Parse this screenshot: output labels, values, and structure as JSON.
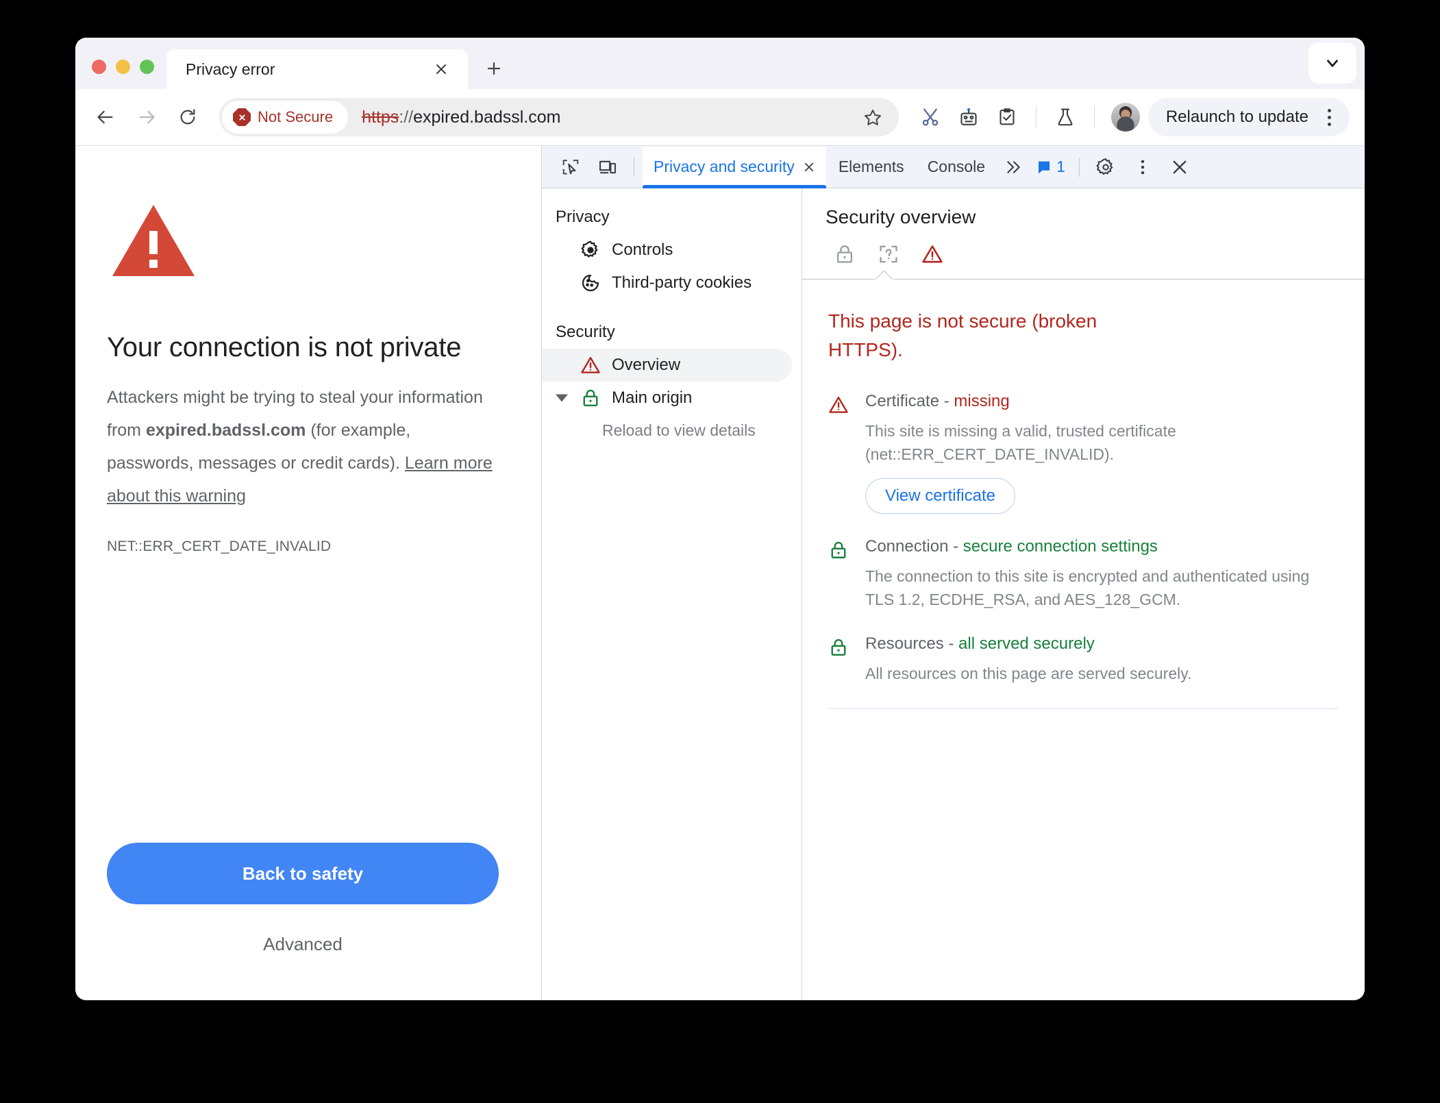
{
  "window": {
    "traffic_lights": [
      "close",
      "minimize",
      "maximize"
    ]
  },
  "tabstrip": {
    "tab_title": "Privacy error",
    "close_label": "Close tab",
    "newtab_label": "New tab",
    "list_tabs_label": "Search tabs"
  },
  "toolbar": {
    "back_label": "Back",
    "forward_label": "Forward",
    "reload_label": "Reload",
    "security_chip": "Not Secure",
    "url_scheme": "https",
    "url_separator": "://",
    "url_host": "expired.badssl.com",
    "bookmark_label": "Bookmark this tab",
    "relaunch_label": "Relaunch to update",
    "icons": [
      "scissors-icon",
      "robot-icon",
      "clipboard-check-icon",
      "flask-icon",
      "avatar"
    ]
  },
  "error_page": {
    "title": "Your connection is not private",
    "body_prefix": "Attackers might be trying to steal your information from ",
    "body_domain": "expired.badssl.com",
    "body_middle": " (for example, passwords, messages or credit cards). ",
    "body_link": "Learn more about this warning",
    "error_code": "NET::ERR_CERT_DATE_INVALID",
    "primary_button": "Back to safety",
    "advanced_button": "Advanced"
  },
  "devtools": {
    "tabs": [
      {
        "label": "Privacy and security",
        "active": true,
        "closable": true
      },
      {
        "label": "Elements",
        "active": false,
        "closable": false
      },
      {
        "label": "Console",
        "active": false,
        "closable": false
      }
    ],
    "more_tabs_label": "More tabs",
    "message_count": "1",
    "settings_label": "Settings",
    "customize_label": "Customize and control DevTools",
    "close_label": "Close DevTools",
    "inspect_label": "Inspect element",
    "device_toolbar_label": "Toggle device toolbar",
    "sidebar": {
      "groups": [
        {
          "title": "Privacy",
          "items": [
            {
              "label": "Controls",
              "icon": "gear-icon",
              "selected": false
            },
            {
              "label": "Third-party cookies",
              "icon": "cookie-icon",
              "selected": false
            }
          ]
        },
        {
          "title": "Security",
          "items": [
            {
              "label": "Overview",
              "icon": "warning-triangle-icon",
              "selected": true
            },
            {
              "label": "Main origin",
              "icon": "lock-green-icon",
              "selected": false,
              "expandable": true
            }
          ]
        }
      ],
      "subtext": "Reload to view details"
    },
    "main": {
      "title": "Security overview",
      "chips": [
        {
          "icon": "lock-gray-icon",
          "active": false
        },
        {
          "icon": "certificate-unknown-icon",
          "active": false
        },
        {
          "icon": "warning-triangle-icon",
          "active": true
        }
      ],
      "summary": "This page is not secure (broken HTTPS).",
      "rows": [
        {
          "icon": "warning-triangle-icon",
          "label": "Certificate",
          "dash": " - ",
          "value": "missing",
          "value_state": "bad",
          "description": "This site is missing a valid, trusted certificate (net::ERR_CERT_DATE_INVALID).",
          "button": "View certificate"
        },
        {
          "icon": "lock-green-icon",
          "label": "Connection",
          "dash": " - ",
          "value": "secure connection settings",
          "value_state": "good",
          "description": "The connection to this site is encrypted and authenticated using TLS 1.2, ECDHE_RSA, and AES_128_GCM.",
          "button": null
        },
        {
          "icon": "lock-green-icon",
          "label": "Resources",
          "dash": " - ",
          "value": "all served securely",
          "value_state": "good",
          "description": "All resources on this page are served securely.",
          "button": null
        }
      ]
    }
  },
  "colors": {
    "danger": "#b3261e",
    "danger_chip": "#a8312a",
    "success": "#18803c",
    "accent_blue": "#1a73e8",
    "button_blue": "#4285f4",
    "warning_triangle": "#d34836"
  }
}
